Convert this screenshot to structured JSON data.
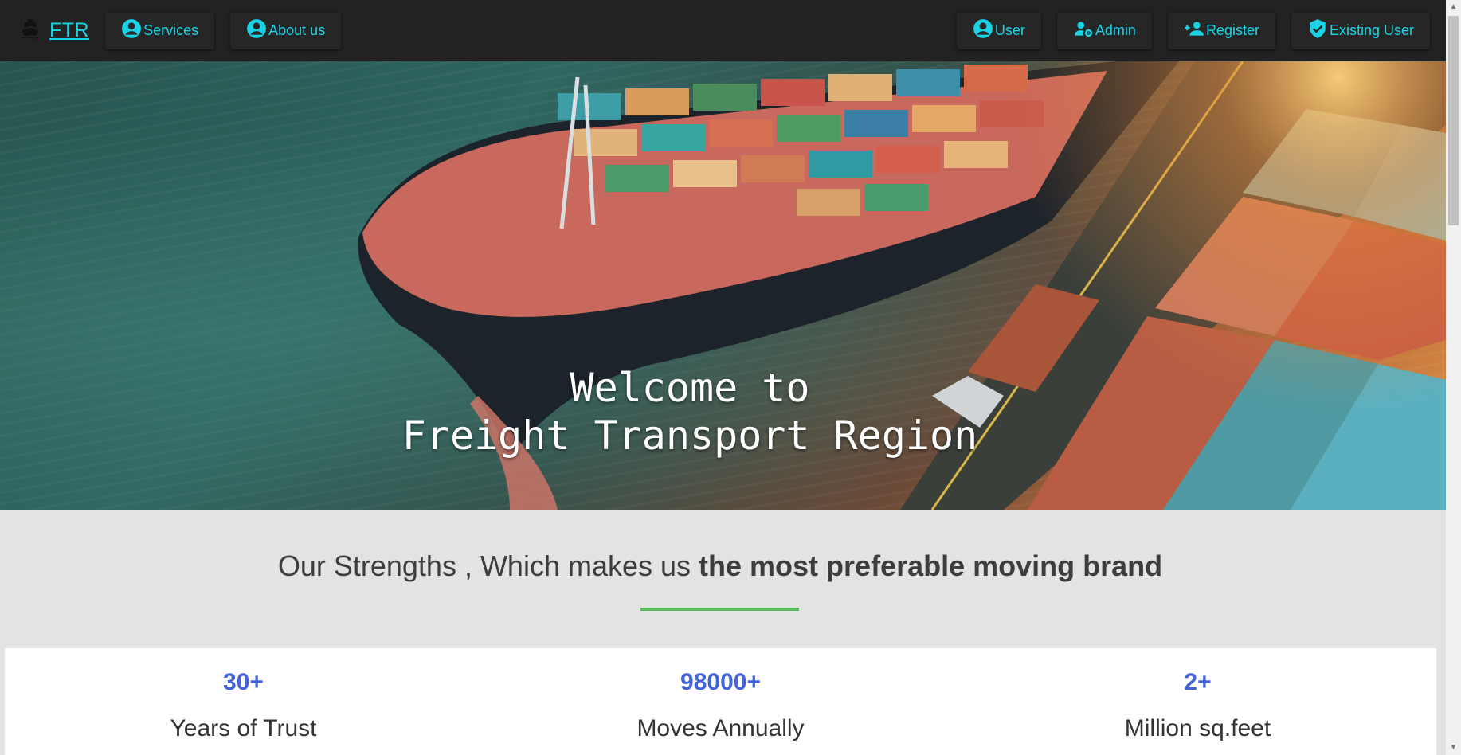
{
  "navbar": {
    "brand": "FTR",
    "left_items": [
      {
        "label": "Services",
        "icon": "account-circle-icon"
      },
      {
        "label": "About us",
        "icon": "account-circle-icon"
      }
    ],
    "right_items": [
      {
        "label": "User",
        "icon": "account-circle-icon"
      },
      {
        "label": "Admin",
        "icon": "user-cog-icon"
      },
      {
        "label": "Register",
        "icon": "user-plus-icon"
      },
      {
        "label": "Existing User",
        "icon": "verified-shield-icon"
      }
    ]
  },
  "hero": {
    "line1": "Welcome to",
    "line2": "Freight Transport Region"
  },
  "strengths": {
    "heading_plain": "Our Strengths , Which makes us ",
    "heading_bold": "the most preferable moving brand"
  },
  "stats": [
    {
      "value": "30+",
      "label": "Years of Trust"
    },
    {
      "value": "98000+",
      "label": "Moves Annually"
    },
    {
      "value": "2+",
      "label": "Million sq.feet"
    }
  ],
  "colors": {
    "nav_bg": "#222222",
    "accent_cyan": "#19d3e6",
    "stat_blue": "#4363d8",
    "underline_green": "#5cb85c"
  }
}
